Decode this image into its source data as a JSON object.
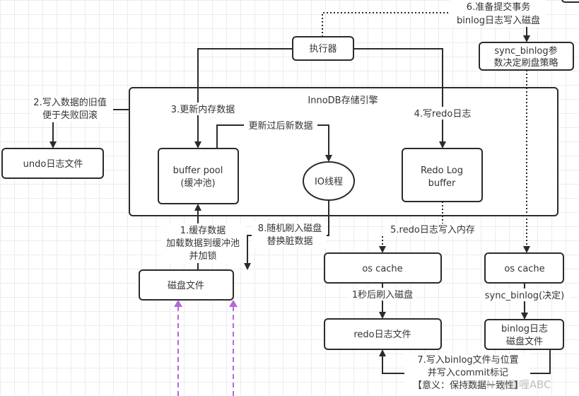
{
  "nodes": {
    "executor": "执行器",
    "sync_binlog": [
      "sync_binlog参",
      "数决定刷盘策略"
    ],
    "innodb": "InnoDB存储引擎",
    "undo": "undo日志文件",
    "buffer_pool": [
      "buffer pool",
      "(缓冲池)"
    ],
    "io_thread": "IO线程",
    "redo_buffer": [
      "Redo Log",
      "buffer"
    ],
    "disk_file": "磁盘文件",
    "os_cache_redo": "os cache",
    "os_cache_binlog": "os cache",
    "redo_file": "redo日志文件",
    "binlog_file": [
      "binlog日志",
      "磁盘文件"
    ]
  },
  "edges": {
    "step1": [
      "1.缓存数据",
      "加载数据到缓冲池",
      "并加锁"
    ],
    "step2": [
      "2.写入数据的旧值",
      "便于失败回滚"
    ],
    "step3": "3.更新内存数据",
    "step4": "4.写redo日志",
    "step5": "5.redo日志写入内存",
    "step6": [
      "6.准备提交事务",
      "binlog日志写入磁盘"
    ],
    "step7": [
      "7.写入binlog文件与位置",
      "并写入commit标记",
      "【意义：保持数据一致性】"
    ],
    "step8": [
      "8.随机刷入磁盘",
      "替换脏数据"
    ],
    "updated_data": "更新过后新数据",
    "flush_1s": "1秒后刷入磁盘",
    "sync_binlog_decide": "sync_binlog(决定)"
  },
  "watermark": "CSDN @咖喱ABC",
  "colors": {
    "line": "#2b2b2b",
    "accent_dashed": "#b866d8"
  }
}
